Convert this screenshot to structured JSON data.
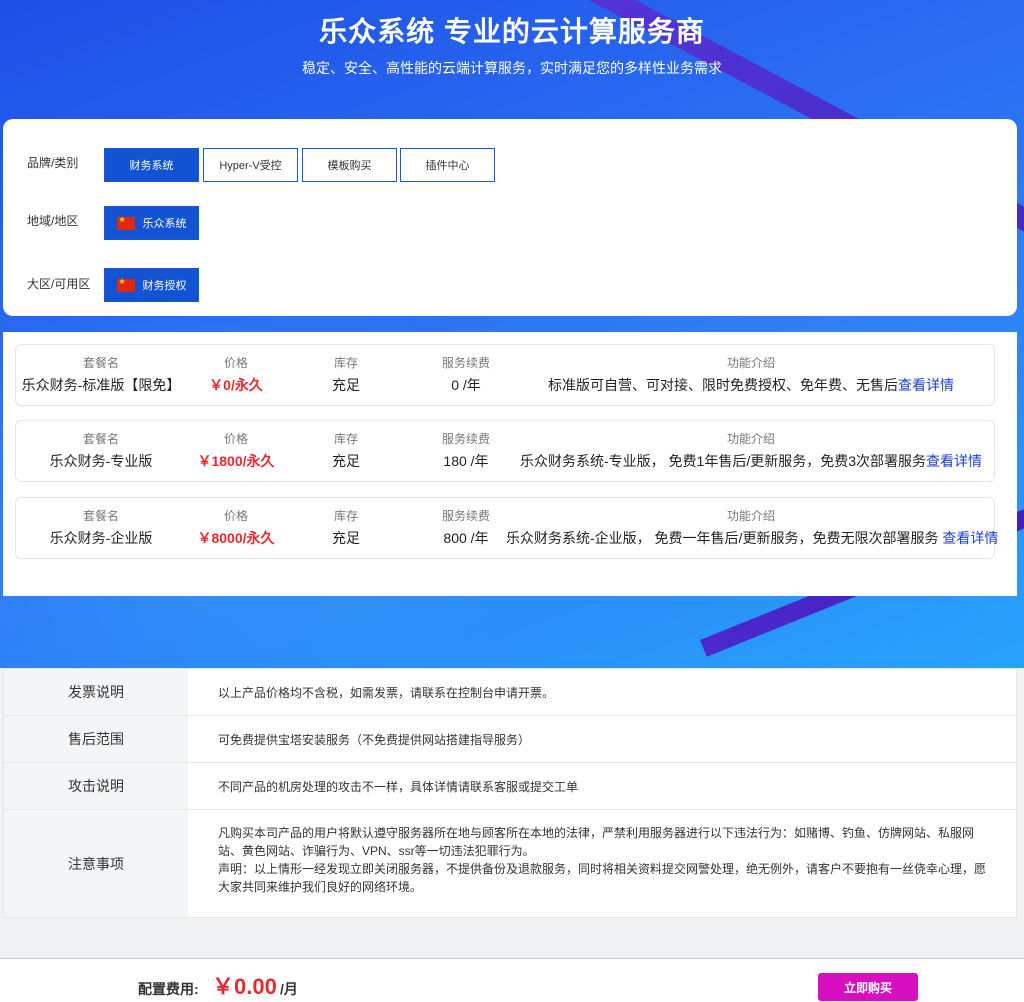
{
  "hero": {
    "title": "乐众系统 专业的云计算服务商",
    "subtitle": "稳定、安全、高性能的云端计算服务，实时满足您的多样性业务需求"
  },
  "filters": {
    "brand": {
      "label": "品牌/类别",
      "options": [
        "财务系统",
        "Hyper-V受控",
        "模板购买",
        "插件中心"
      ],
      "selected": "财务系统"
    },
    "region": {
      "label": "地域/地区",
      "option": "乐众系统"
    },
    "zone": {
      "label": "大区/可用区",
      "option": "财务授权"
    }
  },
  "plan_headers": {
    "name": "套餐名",
    "price": "价格",
    "stock": "库存",
    "renew": "服务续费",
    "features": "功能介绍"
  },
  "plans": [
    {
      "name": "乐众财务-标准版【限免】",
      "price": "￥0",
      "price_unit": "/永久",
      "stock": "充足",
      "renew": "0 /年",
      "features": "标准版可自营、可对接、限时免费授权、免年费、无售后",
      "detail_link": "查看详情"
    },
    {
      "name": "乐众财务-专业版",
      "price": "￥1800",
      "price_unit": "/永久",
      "stock": "充足",
      "renew": "180 /年",
      "features": "乐众财务系统-专业版， 免费1年售后/更新服务，免费3次部署服务",
      "detail_link": "查看详情"
    },
    {
      "name": "乐众财务-企业版",
      "price": "￥8000",
      "price_unit": "/永久",
      "stock": "充足",
      "renew": "800 /年",
      "features": "乐众财务系统-企业版， 免费一年售后/更新服务，免费无限次部署服务 ",
      "detail_link": "查看详情"
    }
  ],
  "notes": [
    {
      "title": "发票说明",
      "lines": [
        "以上产品价格均不含税，如需发票，请联系在控制台申请开票。"
      ]
    },
    {
      "title": "售后范围",
      "lines": [
        "可免费提供宝塔安装服务（不免费提供网站搭建指导服务）"
      ]
    },
    {
      "title": "攻击说明",
      "lines": [
        "不同产品的机房处理的攻击不一样，具体详情请联系客服或提交工单"
      ]
    },
    {
      "title": "注意事项",
      "lines": [
        "凡购买本司产品的用户将默认遵守服务器所在地与顾客所在本地的法律，严禁利用服务器进行以下违法行为：如赌博、钓鱼、仿牌网站、私服网",
        "站、黄色网站、诈骗行为、VPN、ssr等一切违法犯罪行为。",
        "声明：以上情形一经发现立即关闭服务器，不提供备份及退款服务，同时将相关资料提交网警处理，绝无例外，请客户不要抱有一丝侥幸心理，愿",
        "大家共同来维护我们良好的网络环境。"
      ]
    }
  ],
  "footer": {
    "fee_label": "配置费用:",
    "fee_value": "￥0.00",
    "fee_unit": "/月",
    "buy_label": "立即购买"
  },
  "colors": {
    "primary": "#1253d4",
    "price_red": "#e8292e",
    "link_blue": "#1a3ee0",
    "buy_magenta": "#d80fc1"
  }
}
